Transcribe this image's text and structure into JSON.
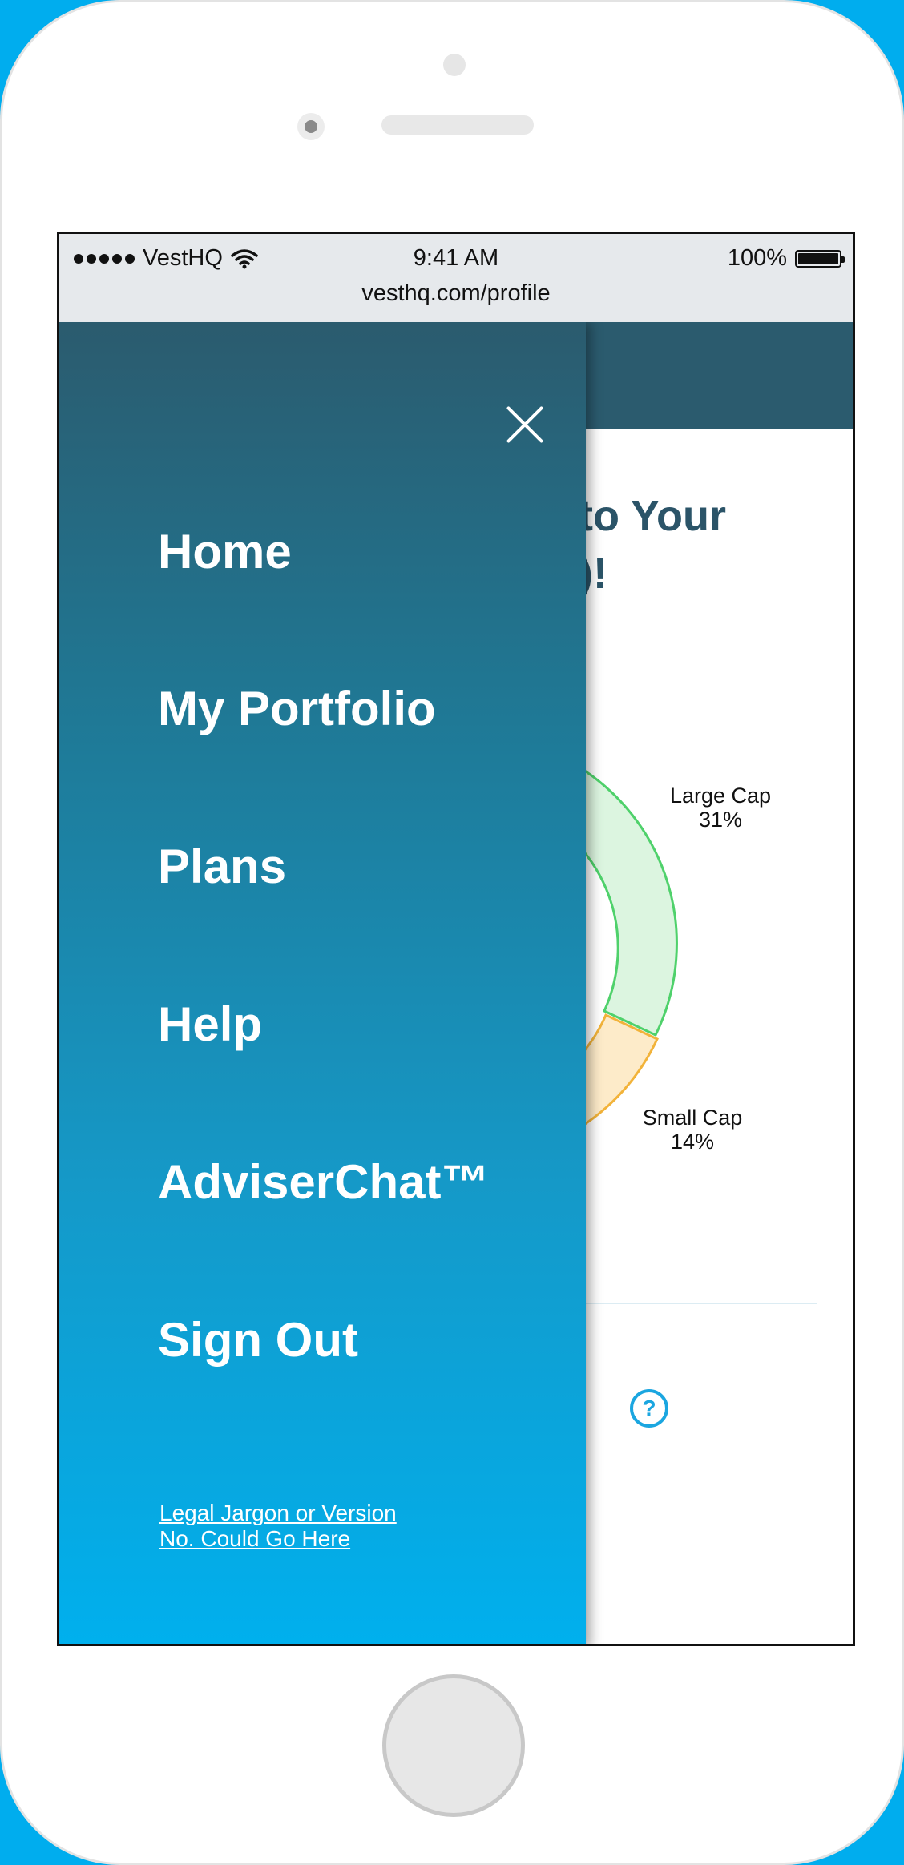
{
  "status_bar": {
    "carrier": "VestHQ",
    "time": "9:41 AM",
    "battery": "100%",
    "url": "vesthq.com/profile"
  },
  "background_page": {
    "title_partial": "to Your\n)!",
    "chart_labels": [
      {
        "name": "Large Cap",
        "value": "31%"
      },
      {
        "name": "Small Cap",
        "value": "14%"
      }
    ],
    "green_fragment": "e",
    "help_icon_glyph": "?"
  },
  "drawer": {
    "close_icon": "close-icon",
    "menu_items": [
      {
        "label": "Home"
      },
      {
        "label": "My Portfolio"
      },
      {
        "label": "Plans"
      },
      {
        "label": "Help"
      },
      {
        "label": "AdviserChat™"
      },
      {
        "label": "Sign Out"
      }
    ],
    "legal_text": "Legal Jargon or Version No. Could Go Here"
  },
  "colors": {
    "frame_background": "#00adee",
    "drawer_top": "#2b5b6e",
    "drawer_bottom": "#00b0ee",
    "large_cap_fill": "#dcf5e0",
    "large_cap_stroke": "#4fd16b",
    "small_cap_fill": "#fdebc9",
    "small_cap_stroke": "#f2b33a"
  }
}
